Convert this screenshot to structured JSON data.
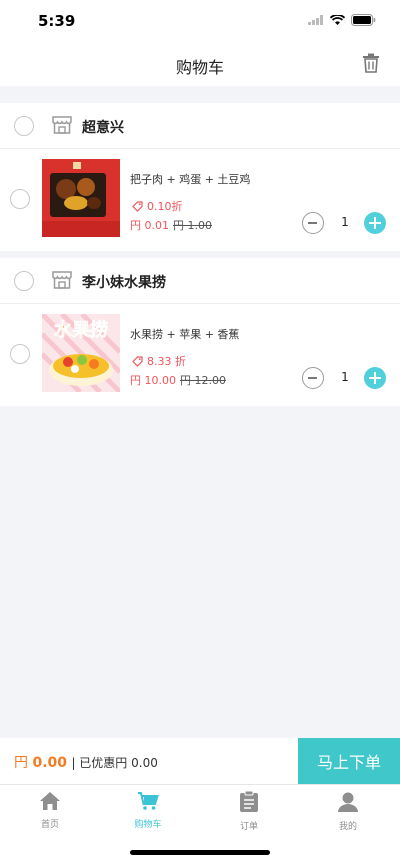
{
  "status": {
    "time": "5:39"
  },
  "nav": {
    "title": "购物车"
  },
  "shops": [
    {
      "name": "超意兴",
      "items": [
        {
          "title": "把子肉 + 鸡蛋 + 土豆鸡",
          "discount": "0.10折",
          "price": "円 0.01",
          "old_price": "円 1.00",
          "qty": "1"
        }
      ]
    },
    {
      "name": "李小妹水果捞",
      "items": [
        {
          "title": "水果捞 + 苹果 + 香蕉",
          "discount": "8.33 折",
          "price": "円 10.00",
          "old_price": "円 12.00",
          "qty": "1",
          "image_text": "水果捞"
        }
      ]
    }
  ],
  "checkout": {
    "currency": "円",
    "total": "0.00",
    "saved_text": "| 已优惠円 0.00",
    "order_button": "马上下单"
  },
  "tabs": [
    {
      "label": "首页",
      "icon": "home-icon"
    },
    {
      "label": "购物车",
      "icon": "cart-icon"
    },
    {
      "label": "订单",
      "icon": "order-icon"
    },
    {
      "label": "我的",
      "icon": "user-icon"
    }
  ],
  "colors": {
    "accent": "#3fc7c9",
    "price": "#f2545b",
    "total": "#f47b20",
    "plus": "#4fd0da"
  }
}
